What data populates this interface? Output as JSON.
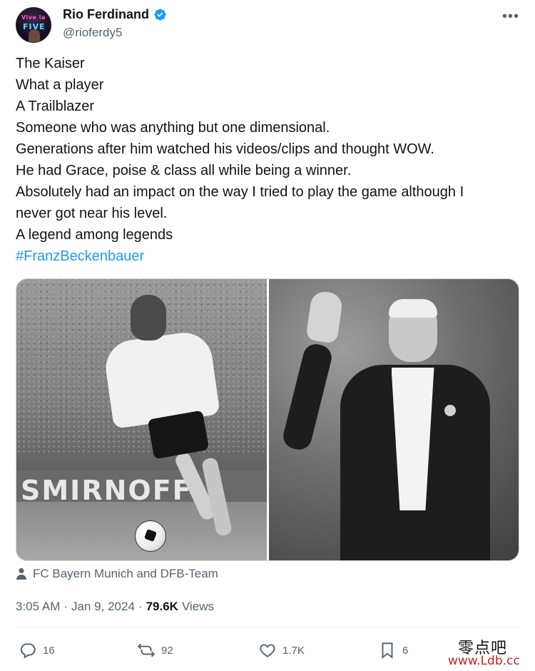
{
  "author": {
    "display_name": "Rio Ferdinand",
    "handle": "@rioferdy5",
    "verified": true,
    "avatar_neon_top": "Vive la",
    "avatar_neon_bottom": "FIVE"
  },
  "tweet": {
    "lines": [
      "The Kaiser",
      "What a player",
      "A Trailblazer",
      "Someone who was anything but one dimensional.",
      "Generations after him watched his videos/clips and thought WOW.",
      "He had Grace, poise & class all while being a winner.",
      "Absolutely had an impact on the way I tried to play the game although I",
      "never got near his level.",
      "A legend among legends"
    ],
    "hashtag": "#FranzBeckenbauer"
  },
  "media": {
    "left_photo_banner_text": "SMIRNOFF",
    "tagged": "FC Bayern Munich and DFB-Team"
  },
  "meta": {
    "time": "3:05 AM",
    "separator": "·",
    "date": "Jan 9, 2024",
    "views_count": "79.6K",
    "views_label": "Views"
  },
  "actions": {
    "replies": "16",
    "reposts": "92",
    "likes": "1.7K",
    "bookmarks": "6"
  },
  "watermark": {
    "chinese": "零点吧",
    "url": "www.Ldb.cc"
  },
  "colors": {
    "link": "#1d9bf0",
    "secondary_text": "#536471",
    "primary_text": "#0f1419",
    "watermark_url": "#d21f1f"
  }
}
